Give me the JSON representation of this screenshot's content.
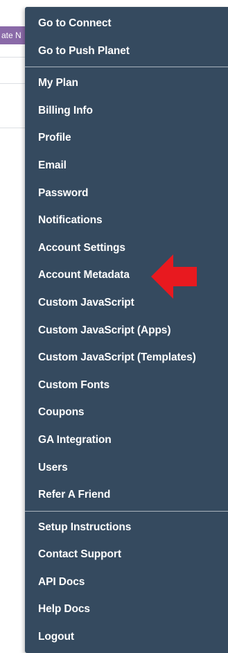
{
  "background": {
    "button_label": "ate N"
  },
  "menu": {
    "group1": [
      {
        "label": "Go to Connect"
      },
      {
        "label": "Go to Push Planet"
      }
    ],
    "group2": [
      {
        "label": "My Plan"
      },
      {
        "label": "Billing Info"
      },
      {
        "label": "Profile"
      },
      {
        "label": "Email"
      },
      {
        "label": "Password"
      },
      {
        "label": "Notifications"
      },
      {
        "label": "Account Settings"
      },
      {
        "label": "Account Metadata"
      },
      {
        "label": "Custom JavaScript"
      },
      {
        "label": "Custom JavaScript (Apps)"
      },
      {
        "label": "Custom JavaScript (Templates)"
      },
      {
        "label": "Custom Fonts"
      },
      {
        "label": "Coupons"
      },
      {
        "label": "GA Integration"
      },
      {
        "label": "Users"
      },
      {
        "label": "Refer A Friend"
      }
    ],
    "group3": [
      {
        "label": "Setup Instructions"
      },
      {
        "label": "Contact Support"
      },
      {
        "label": "API Docs"
      },
      {
        "label": "Help Docs"
      },
      {
        "label": "Logout"
      }
    ]
  },
  "annotation": {
    "arrow_icon": "red-left-arrow-icon",
    "arrow_color": "#e8191f"
  },
  "colors": {
    "menu_background": "#354a5f",
    "menu_text": "#ffffff",
    "background_button": "#8a6aa8"
  }
}
